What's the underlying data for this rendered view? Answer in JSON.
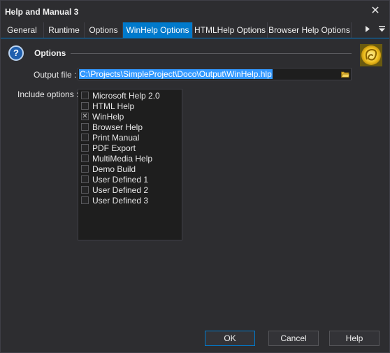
{
  "window": {
    "title": "Help and Manual 3",
    "close_glyph": "✕"
  },
  "tabs": [
    {
      "label": "General",
      "active": false
    },
    {
      "label": "Runtime",
      "active": false
    },
    {
      "label": "Options",
      "active": false
    },
    {
      "label": "WinHelp Options",
      "active": true
    },
    {
      "label": "HTMLHelp Options",
      "active": false
    },
    {
      "label": "Browser Help Options",
      "active": false
    }
  ],
  "tab_nav": {
    "next_icon": "triangle-right-icon",
    "menu_icon": "dropdown-menu-icon"
  },
  "section": {
    "title": "Options",
    "icon": "help-circle-icon"
  },
  "output_file": {
    "label": "Output file :",
    "value": "C:\\Projects\\SimpleProject\\Doco\\Output\\WinHelp.hlp",
    "browse_icon": "folder-icon"
  },
  "include_options": {
    "label": "Include options :",
    "items": [
      {
        "label": "Microsoft Help 2.0",
        "checked": false
      },
      {
        "label": "HTML Help",
        "checked": false
      },
      {
        "label": "WinHelp",
        "checked": true
      },
      {
        "label": "Browser Help",
        "checked": false
      },
      {
        "label": "Print Manual",
        "checked": false
      },
      {
        "label": "PDF Export",
        "checked": false
      },
      {
        "label": "MultiMedia Help",
        "checked": false
      },
      {
        "label": "Demo Build",
        "checked": false
      },
      {
        "label": "User Defined 1",
        "checked": false
      },
      {
        "label": "User Defined 2",
        "checked": false
      },
      {
        "label": "User Defined 3",
        "checked": false
      }
    ]
  },
  "buttons": {
    "ok": "OK",
    "cancel": "Cancel",
    "help": "Help"
  },
  "colors": {
    "accent": "#007acc",
    "background": "#2d2d30",
    "selection": "#3399ff"
  }
}
